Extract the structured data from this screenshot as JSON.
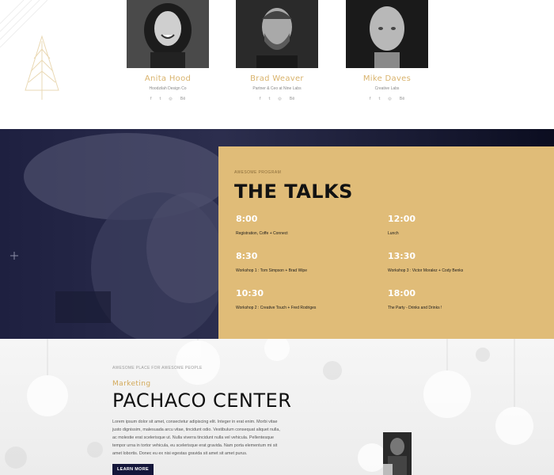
{
  "speakers": [
    {
      "name": "Anita Hood",
      "role": "Hoodzilah Design Co",
      "socials": [
        "f",
        "t",
        "◎",
        "Bē"
      ]
    },
    {
      "name": "Brad Weaver",
      "role": "Partner & Ceo at Nine Labs",
      "socials": [
        "f",
        "t",
        "◎",
        "Bē"
      ]
    },
    {
      "name": "Mike Daves",
      "role": "Creative Labs",
      "socials": [
        "f",
        "t",
        "◎",
        "Bē"
      ]
    }
  ],
  "talks": {
    "kicker": "AWESOME PROGRAM",
    "title": "THE TALKS",
    "items": [
      {
        "time": "8:00",
        "desc": "Registration, Coffe + Connect"
      },
      {
        "time": "12:00",
        "desc": "Lunch"
      },
      {
        "time": "8:30",
        "desc": "Workshop 1 : Tom Simpson + Brad Wipe"
      },
      {
        "time": "13:30",
        "desc": "Workshop 3 : Victor Moralez + Cody Benks"
      },
      {
        "time": "10:30",
        "desc": "Workshop 2 : Creative Touch + Fred Rodriges"
      },
      {
        "time": "18:00",
        "desc": "The Party - Drinks and Drinks !"
      }
    ]
  },
  "venue": {
    "kicker": "AWESOME PLACE FOR AWESOME PEOPLE",
    "subtitle": "Marketing",
    "title": "PACHACO CENTER",
    "body_lines": [
      "Lorem ipsum dolor sit amet, consectetur adipiscing elit. Integer in erat enim. Morbi vitae",
      "justo dignissim, malesuada arcu vitae, tincidunt odio. Vestibulum consequat aliquet nulla,",
      "ac molestie erat scelerisque ut. Nulla viverra tincidunt nulla vel vehicula. Pellentesque",
      "tempor urna in tortor vehicula, eu scelerisque erat gravida. Nam porta elementum mi sit",
      "amet lobortis. Donec eu ex nisi egestas gravida sit amet sit amet purus."
    ],
    "button": "LEARN MORE"
  },
  "colors": {
    "gold": "#e0bc78",
    "navy": "#14163a",
    "accent_text": "#d9b36c"
  }
}
